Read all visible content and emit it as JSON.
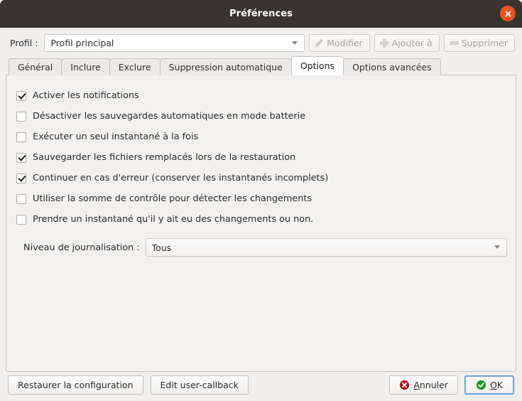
{
  "window": {
    "title": "Préférences",
    "close_icon": "close-icon",
    "accent_close": "#e95420",
    "titlebar_bg": "#393430",
    "content_bg": "#f0efee"
  },
  "profile": {
    "label": "Profil :",
    "selected": "Profil principal",
    "buttons": [
      {
        "label": "Modifier",
        "icon": "pencil-icon",
        "enabled": false
      },
      {
        "label": "Ajouter à",
        "icon": "plus-icon",
        "enabled": false
      },
      {
        "label": "Supprimer",
        "icon": "minus-icon",
        "enabled": false
      }
    ]
  },
  "tabs": [
    {
      "label": "Général",
      "active": false
    },
    {
      "label": "Inclure",
      "active": false
    },
    {
      "label": "Exclure",
      "active": false
    },
    {
      "label": "Suppression automatique",
      "active": false
    },
    {
      "label": "Options",
      "active": true
    },
    {
      "label": "Options avancées",
      "active": false
    }
  ],
  "options": {
    "checkboxes": [
      {
        "label": "Activer les notifications",
        "checked": true
      },
      {
        "label": "Désactiver les sauvegardes automatiques en mode batterie",
        "checked": false
      },
      {
        "label": "Exécuter un seul instantané à la fois",
        "checked": false
      },
      {
        "label": "Sauvegarder les fichiers remplacés lors de la restauration",
        "checked": true
      },
      {
        "label": "Continuer en cas d'erreur (conserver les instantanés incomplets)",
        "checked": true
      },
      {
        "label": "Utiliser la somme de contrôle pour détecter les changements",
        "checked": false
      },
      {
        "label": "Prendre un instantané qu'il y ait eu des changements ou non.",
        "checked": false
      }
    ],
    "log_level": {
      "label": "Niveau de journalisation :",
      "selected": "Tous"
    }
  },
  "action_bar": {
    "restore_config": "Restaurer la configuration",
    "edit_callback": "Edit user-callback",
    "cancel": {
      "label": "Annuler",
      "mnemonic": "A",
      "icon": "cancel-icon",
      "color": "#b01116"
    },
    "ok": {
      "label": "OK",
      "mnemonic": "O",
      "icon": "ok-check-icon",
      "color": "#1a9b28",
      "focused": true
    }
  }
}
